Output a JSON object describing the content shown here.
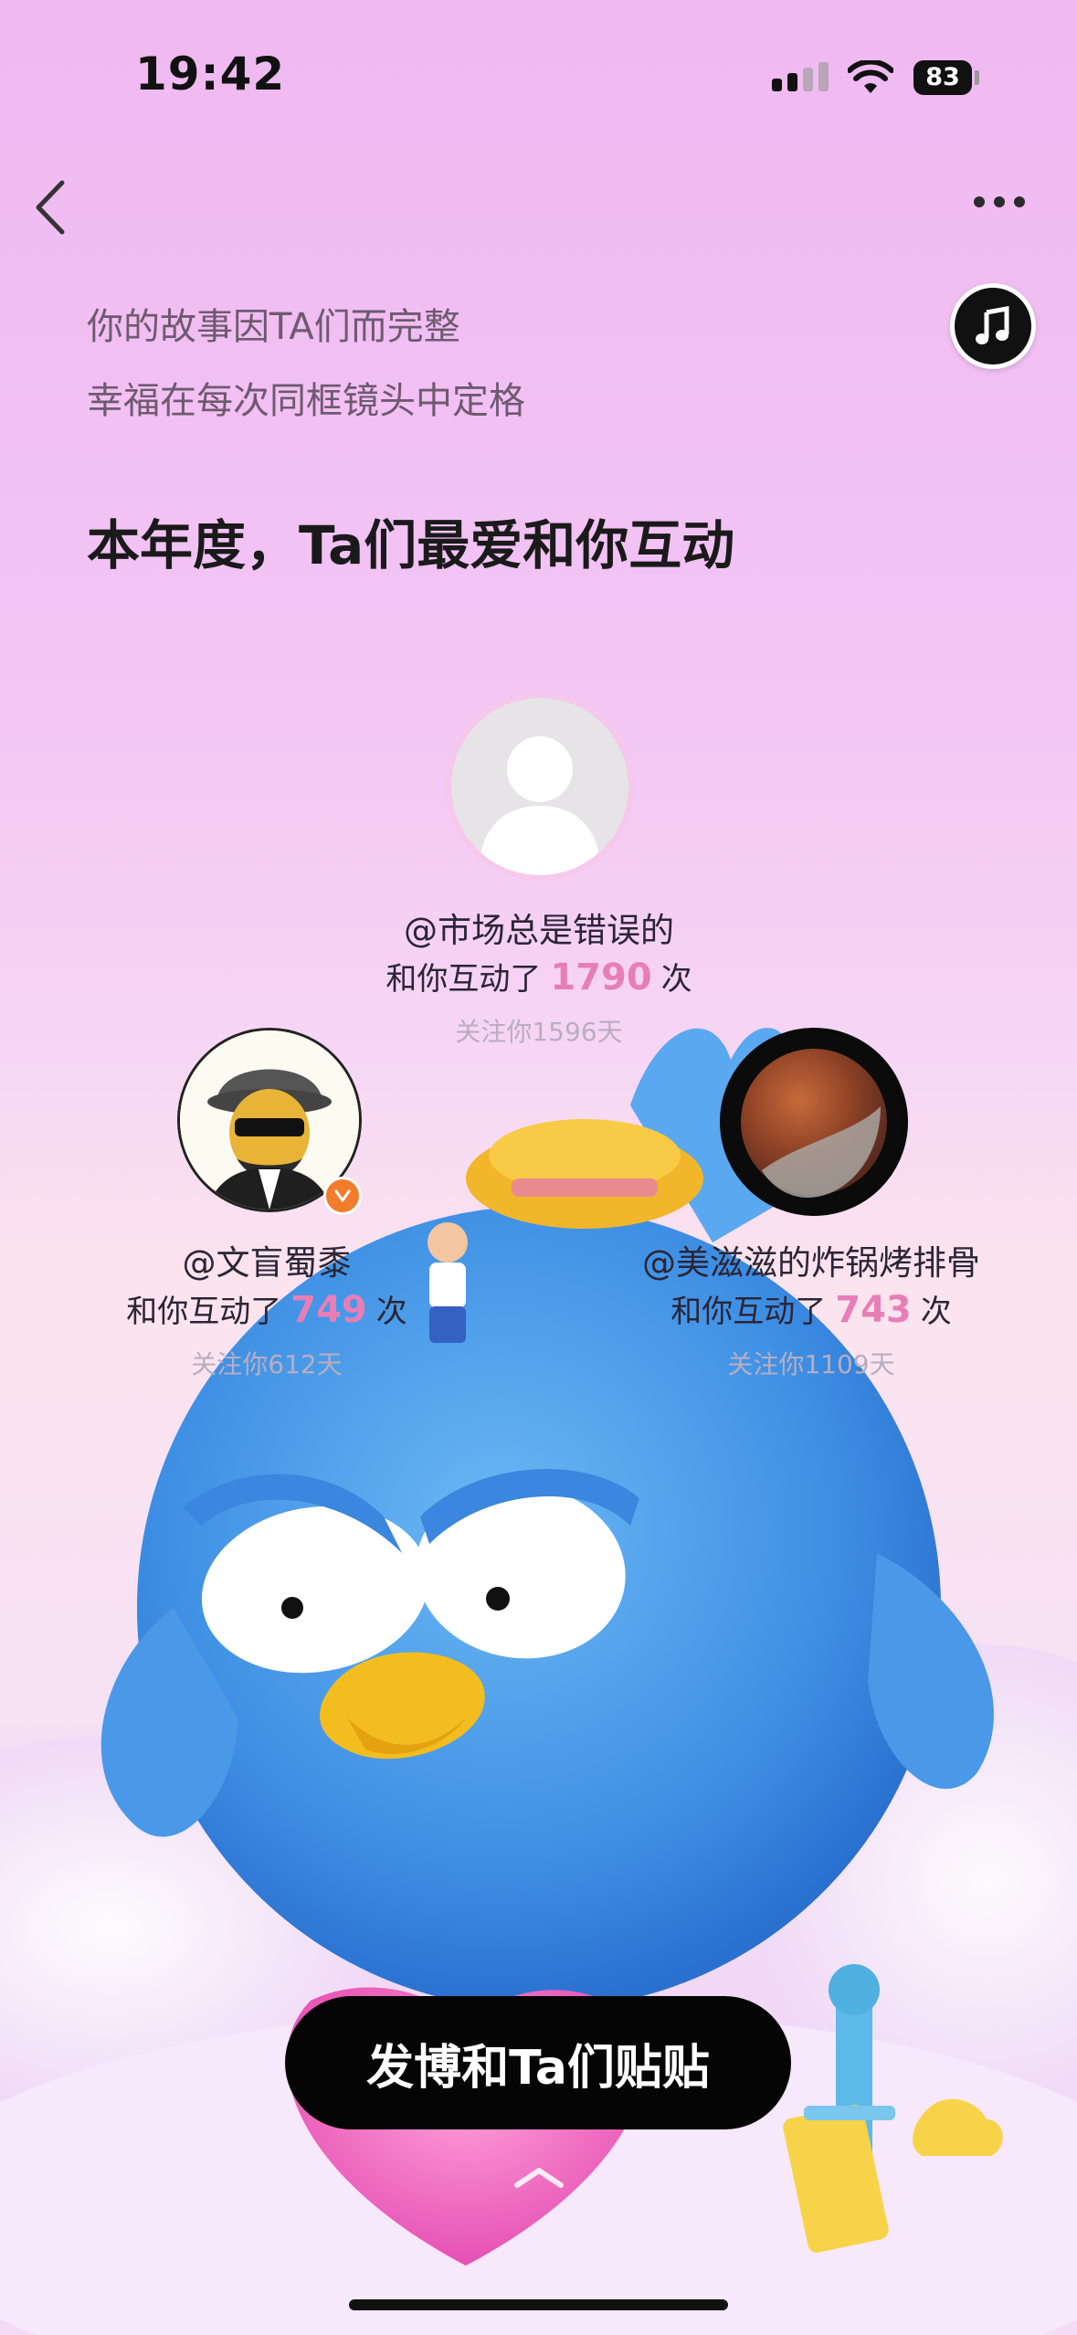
{
  "status_bar": {
    "time": "19:42",
    "battery": "83"
  },
  "intro": {
    "line1": "你的故事因TA们而完整",
    "line2": "幸福在每次同框镜头中定格"
  },
  "headline": "本年度，Ta们最爱和你互动",
  "users": [
    {
      "handle": "@市场总是错误的",
      "interact_prefix": "和你互动了",
      "count": "1790",
      "unit": "次",
      "follow": "关注你1596天"
    },
    {
      "handle": "@文盲蜀黍",
      "interact_prefix": "和你互动了",
      "count": "749",
      "unit": "次",
      "follow": "关注你612天"
    },
    {
      "handle": "@美滋滋的炸锅烤排骨",
      "interact_prefix": "和你互动了",
      "count": "743",
      "unit": "次",
      "follow": "关注你1109天"
    }
  ],
  "cta_label": "发博和Ta们贴贴",
  "icons": [
    "back-icon",
    "more-icon",
    "music-note-icon",
    "chevron-up-icon",
    "verified-badge-icon"
  ],
  "colors": {
    "accent": "#e77fb6",
    "cta_bg": "#050505"
  }
}
